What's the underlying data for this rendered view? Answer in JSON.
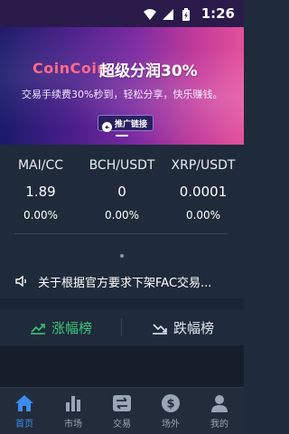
{
  "status_bar": {
    "time": "1:26",
    "icons": [
      "wifi-icon",
      "signal-icon",
      "battery-icon"
    ]
  },
  "banner": {
    "logo": "CoinCoin",
    "headline": "超级分润30%",
    "subtitle": "交易手续费30%秒到，轻松分享，快乐赚钱。",
    "chip_label": "推广链接",
    "chip_icon": "share-icon"
  },
  "ticker": [
    {
      "pair": "MAI/CC",
      "price": "1.89",
      "change": "0.00%"
    },
    {
      "pair": "BCH/USDT",
      "price": "0",
      "change": "0.00%"
    },
    {
      "pair": "XRP/USDT",
      "price": "0.0001",
      "change": "0.00%"
    }
  ],
  "notice": {
    "icon": "speaker-icon",
    "text": "关于根据官方要求下架FAC交易..."
  },
  "rank_tabs": [
    {
      "label": "涨幅榜",
      "icon": "trend-up-icon",
      "active": true
    },
    {
      "label": "跌幅榜",
      "icon": "trend-down-icon",
      "active": false
    }
  ],
  "bottom_nav": [
    {
      "label": "首页",
      "icon": "home-icon",
      "active": true
    },
    {
      "label": "市场",
      "icon": "bar-chart-icon",
      "active": false
    },
    {
      "label": "交易",
      "icon": "exchange-icon",
      "active": false
    },
    {
      "label": "场外",
      "icon": "dollar-icon",
      "active": false
    },
    {
      "label": "我的",
      "icon": "user-icon",
      "active": false
    }
  ],
  "colors": {
    "background": "#1f2a3a",
    "rise_green": "#3cc47a",
    "nav_active_blue": "#3c8cf0",
    "nav_inactive": "#9aa5b5"
  }
}
